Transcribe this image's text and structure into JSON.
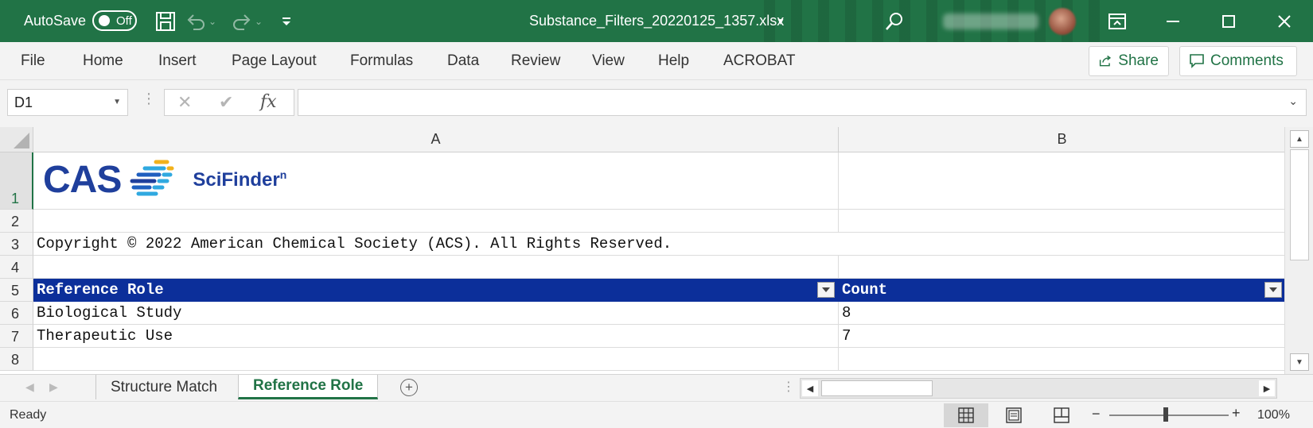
{
  "titlebar": {
    "autosave_label": "AutoSave",
    "autosave_state": "Off",
    "doc_title": "Substance_Filters_20220125_1357.xlsx",
    "accent": "#217346"
  },
  "ribbon": {
    "tabs": [
      "File",
      "Home",
      "Insert",
      "Page Layout",
      "Formulas",
      "Data",
      "Review",
      "View",
      "Help",
      "ACROBAT"
    ],
    "share_label": "Share",
    "comments_label": "Comments"
  },
  "formula_bar": {
    "name_box": "D1",
    "fx_label": "fx",
    "formula": ""
  },
  "grid": {
    "columns": [
      "A",
      "B"
    ],
    "rows": [
      "1",
      "2",
      "3",
      "4",
      "5",
      "6",
      "7",
      "8"
    ],
    "logo": {
      "cas": "CAS",
      "scifinder": "SciFinder",
      "scifinder_sup": "n",
      "brand_color": "#1f3f9c"
    },
    "copyright": "Copyright © 2022 American Chemical Society (ACS).  All Rights Reserved.",
    "table_header": [
      "Reference Role",
      "Count"
    ],
    "table_header_color": "#0c2f9a",
    "table_rows": [
      [
        "Biological Study",
        "8"
      ],
      [
        "Therapeutic Use",
        "7"
      ]
    ]
  },
  "sheets": {
    "tabs": [
      "Structure Match",
      "Reference Role"
    ],
    "active": "Reference Role"
  },
  "status": {
    "ready": "Ready",
    "zoom": "100%"
  }
}
